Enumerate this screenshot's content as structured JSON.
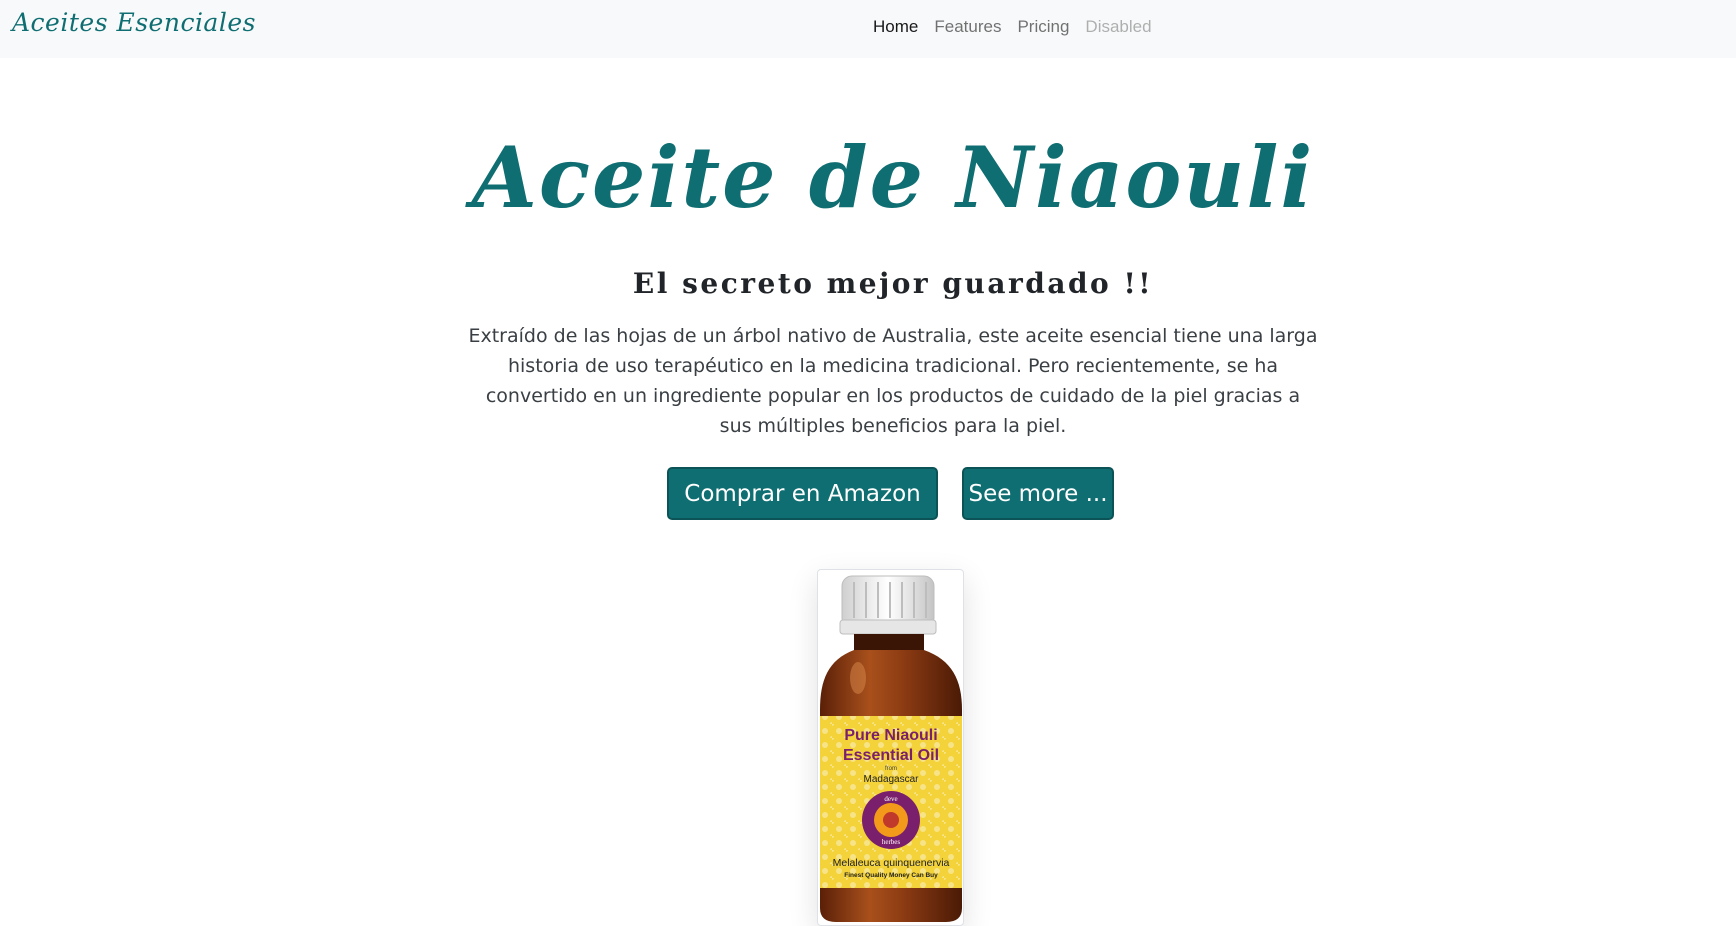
{
  "navbar": {
    "brand": "Aceites Esenciales",
    "links": [
      {
        "label": "Home",
        "state": "active"
      },
      {
        "label": "Features",
        "state": "normal"
      },
      {
        "label": "Pricing",
        "state": "normal"
      },
      {
        "label": "Disabled",
        "state": "disabled"
      }
    ]
  },
  "hero": {
    "title": "Aceite de Niaouli",
    "subtitle": "El secreto mejor guardado !!",
    "description": "Extraído de las hojas de un árbol nativo de Australia, este aceite esencial tiene una larga historia de uso terapéutico en la medicina tradicional. Pero recientemente, se ha convertido en un ingrediente popular en los productos de cuidado de la piel gracias a sus múltiples beneficios para la piel.",
    "buttons": {
      "amazon": "Comprar en Amazon",
      "more": "See more ..."
    }
  },
  "product": {
    "label_line1": "Pure Niaouli",
    "label_line2": "Essential Oil",
    "from": "from",
    "origin": "Madagascar",
    "logo_top": "deve",
    "logo_bottom": "herbes",
    "botanical": "Melaleuca quinquenervia",
    "tagline": "Finest Quality Money Can Buy"
  },
  "colors": {
    "accent": "#0f6e72",
    "navbar_bg": "#f8f9fa",
    "bottle_amber": "#8a3a12",
    "label_yellow": "#f3d23a",
    "label_text": "#7a1f6b"
  }
}
